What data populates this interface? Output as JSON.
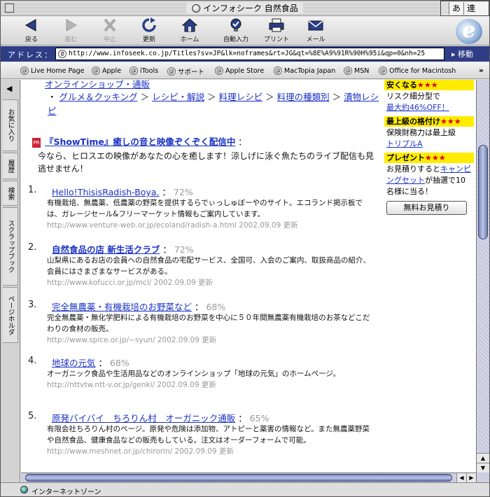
{
  "window": {
    "title": "インフォシーク 自然食品"
  },
  "ime": {
    "mode1": "あ",
    "mode2": "連"
  },
  "toolbar": {
    "back": "戻る",
    "forward": "進む",
    "stop": "中止",
    "refresh": "更新",
    "home": "ホーム",
    "autofill": "自動入力",
    "print": "プリント",
    "mail": "メール"
  },
  "address": {
    "label": "アドレス：",
    "url": "http://www.infoseek.co.jp/Titles?sv=JP&lk=noframes&rt=JG&qt=%8E%A9%91R%90H%95i&qp=0&nh=25",
    "go": "移動"
  },
  "favorites": [
    "Live Home Page",
    "Apple",
    "iTools",
    "サポート",
    "Apple Store",
    "MacTopia Japan",
    "MSN",
    "Office for Macintosh"
  ],
  "sidetabs": [
    "お気に入り",
    "履歴",
    "検索",
    "スクラップブック",
    "ページホルダ"
  ],
  "breadcrumb": {
    "top_partial": "オンラインショップ・通販",
    "items": [
      "グルメ＆クッキング",
      "レシピ・解説",
      "料理レシピ",
      "料理の種類別",
      "漬物レシピ"
    ],
    "bullet": "・",
    "sep": "＞"
  },
  "feature": {
    "icon_text": "PR",
    "title": "『ShowTime』癒しの音と映像ぞくぞく配信中",
    "colon": "：",
    "desc": "今なら、ヒロスエの映像があなたの心を癒します！涼しげに泳ぐ魚たちのライブ配信も見逃せません！"
  },
  "results": [
    {
      "num": "1.",
      "title": "Hello!ThisisRadish-Boya.",
      "score": "72%",
      "desc": "有機栽培、無農薬、低農薬の野菜を提供するらでぃっしゅぼーやのサイト。エコランド掲示板では、ガレージセール&フリーマーケット情報もご案内しています。",
      "url": "http://www.venture-web.or.jp/ecoland/radish-a.html",
      "date": "2002.09.09 更新"
    },
    {
      "num": "2.",
      "title": "自然食品の店 新生活クラブ",
      "score": "72%",
      "desc": "山梨県にあるお店の会員への自然食品の宅配サービス、全国可、入会のご案内、取扱商品の紹介、会員にはさまざまなサービスがある。",
      "url": "http://www.kofucci.or.jp/mcl/",
      "date": "2002.09.09 更新"
    },
    {
      "num": "3.",
      "title": "完全無農薬・有機栽培のお野菜など",
      "score": "68%",
      "desc": "完全無農薬・無化学肥料による有機栽培のお野菜を中心に５０年間無農薬有機栽培のお茶などこだわりの食材の販売。",
      "url": "http://www.spice.or.jp/~syun/",
      "date": "2002.09.09 更新"
    },
    {
      "num": "4.",
      "title": "地球の元気",
      "score": "68%",
      "desc": "オーガニック食品や生活用品などのオンラインショップ「地球の元気」のホームページ。",
      "url": "http://nttvtw.ntt-v.or.jp/genki/",
      "date": "2002.09.09 更新"
    },
    {
      "num": "5.",
      "title": "原発バイバイ　ちろりん村　オーガニック通販",
      "score": "65%",
      "desc": "有限会社ちろりん村のページ。原発や危険は添加物、アトピーと薬害の情報など。また無農薬野菜や自然食品、健康食品などの販売もしている。注文はオーダーフォームで可能。",
      "url": "http://www.meshnet.or.jp/chirorin/",
      "date": "2002.09.09 更新"
    }
  ],
  "ads": {
    "ad1": {
      "head": "安くなる",
      "stars": "★★★",
      "line1": "リスク細分型で",
      "link": "最大約46%OFF！"
    },
    "ad2": {
      "head": "最上級の格付け",
      "stars": "★★★",
      "line1": "保険財務力は最上級",
      "link": "トリプルA"
    },
    "ad3": {
      "head": "プレゼント",
      "stars": "★★★",
      "line1a": "お見積りすると",
      "link": "キャンピングセット",
      "line1b": "が抽選で10名様に当る！"
    },
    "button": "無料お見積り"
  },
  "status": {
    "zone": "インターネットゾーン"
  },
  "colors": {
    "link": "#1a32c7",
    "ad_highlight": "#ffec00",
    "address_bar": "#2e3d86"
  }
}
